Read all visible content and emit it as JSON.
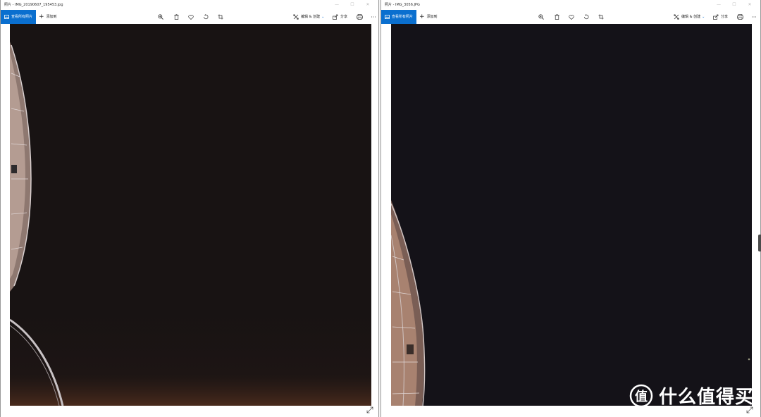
{
  "left_window": {
    "title": "照片 - IMG_20190607_195453.jpg",
    "toolbar": {
      "view_all_label": "查看所有照片",
      "add_label": "添加到",
      "edit_create_label": "编辑 & 创建",
      "share_label": "分享",
      "icons": [
        "zoom-in-icon",
        "delete-icon",
        "heart-icon",
        "rotate-icon",
        "crop-icon",
        "print-icon",
        "more-icon"
      ]
    }
  },
  "right_window": {
    "title": "照片 - IMG_3056.JPG",
    "toolbar": {
      "view_all_label": "查看所有照片",
      "add_label": "添加到",
      "edit_create_label": "编辑 & 创建",
      "share_label": "分享",
      "icons": [
        "zoom-in-icon",
        "delete-icon",
        "heart-icon",
        "rotate-icon",
        "crop-icon",
        "print-icon",
        "more-icon"
      ]
    }
  },
  "caption_buttons": {
    "minimize": "—",
    "maximize": "☐",
    "close": "✕"
  },
  "toolbar_more": "···",
  "watermark": {
    "text": "什么值得买",
    "symbol": "值"
  },
  "colors": {
    "accent": "#0a6fcf",
    "left_photo_bg": "#181313",
    "right_photo_bg": "#141218"
  }
}
